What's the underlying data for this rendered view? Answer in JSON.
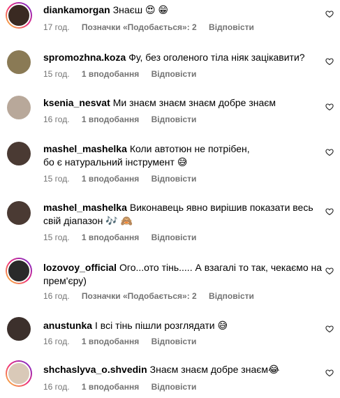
{
  "comments": [
    {
      "username": "diankamorgan",
      "text": "Знаєш 😍 😁",
      "time": "17 год.",
      "likes": "Позначки «Подобається»: 2",
      "reply": "Відповісти"
    },
    {
      "username": "spromozhna.koza",
      "text": "Фу, без оголеного тіла ніяк зацікавити?",
      "time": "15 год.",
      "likes": "1 вподобання",
      "reply": "Відповісти"
    },
    {
      "username": "ksenia_nesvat",
      "text": "Ми знаєм знаєм знаєм добре знаєм",
      "time": "16 год.",
      "likes": "1 вподобання",
      "reply": "Відповісти"
    },
    {
      "username": "mashel_mashelka",
      "text": "Коли автотюн не потрібен, бо є натуральний інструмент 😅",
      "time": "15 год.",
      "likes": "1 вподобання",
      "reply": "Відповісти"
    },
    {
      "username": "mashel_mashelka",
      "text": "Виконавець явно вирішив показати весь свій діапазон 🎶 🙈",
      "time": "15 год.",
      "likes": "1 вподобання",
      "reply": "Відповісти"
    },
    {
      "username": "lozovoy_official",
      "text": "Ого...ото тінь..... А взагалі то так, чекаємо на прем'єру)",
      "time": "16 год.",
      "likes": "Позначки «Подобається»: 2",
      "reply": "Відповісти"
    },
    {
      "username": "anustunka",
      "text": "І всі тінь пішли розглядати 😅",
      "time": "16 год.",
      "likes": "1 вподобання",
      "reply": "Відповісти"
    },
    {
      "username": "shchaslyva_o.shvedin",
      "text": "Знаєм знаєм добре знаєм😂",
      "time": "16 год.",
      "likes": "1 вподобання",
      "reply": "Відповісти"
    }
  ],
  "icons": {
    "like": "heart-outline-icon"
  },
  "colors": {
    "meta": "#737373",
    "story_ring": "#ee2a7b"
  }
}
